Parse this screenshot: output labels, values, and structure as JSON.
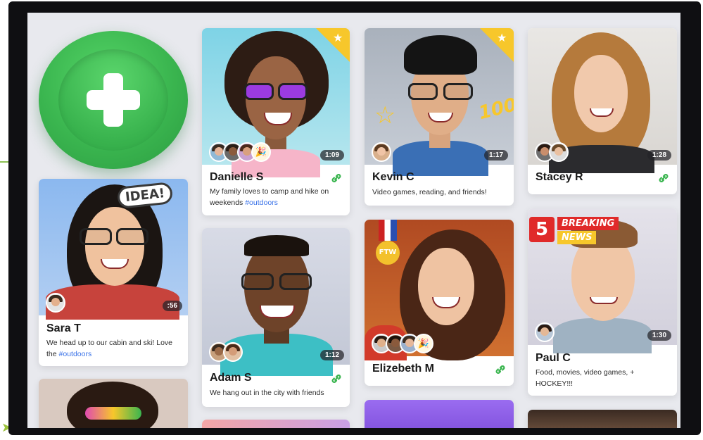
{
  "add_button": {
    "icon": "plus-icon"
  },
  "cards": [
    {
      "name": "Danielle S",
      "bio": "My family loves to camp and hike on weekends ",
      "tag": "#outdoors",
      "duration": "1:09",
      "starred": true
    },
    {
      "name": "Kevin C",
      "bio": "Video games, reading, and friends!",
      "duration": "1:17",
      "starred": true
    },
    {
      "name": "Stacey R",
      "duration": "1:28"
    },
    {
      "name": "Sara T",
      "bio": "We head up to our cabin and ski! Love the ",
      "tag": "#outdoors",
      "duration": ":56"
    },
    {
      "name": "Adam S",
      "bio": "We hang out in the city with friends",
      "duration": "1:12"
    },
    {
      "name": "Elizebeth M"
    },
    {
      "name": "Paul C",
      "bio": "Food, movies, video games, + HOCKEY!!!",
      "duration": "1:30"
    }
  ],
  "stickers": {
    "idea": "IDEA!",
    "hundred": "100",
    "ftw": "FTW",
    "breaking_num": "5",
    "breaking1": "BREAKING",
    "breaking2": "NEWS"
  },
  "colors": {
    "accent_green": "#3ab54f",
    "link_blue": "#3b73e8",
    "star_yellow": "#f7c72b"
  }
}
